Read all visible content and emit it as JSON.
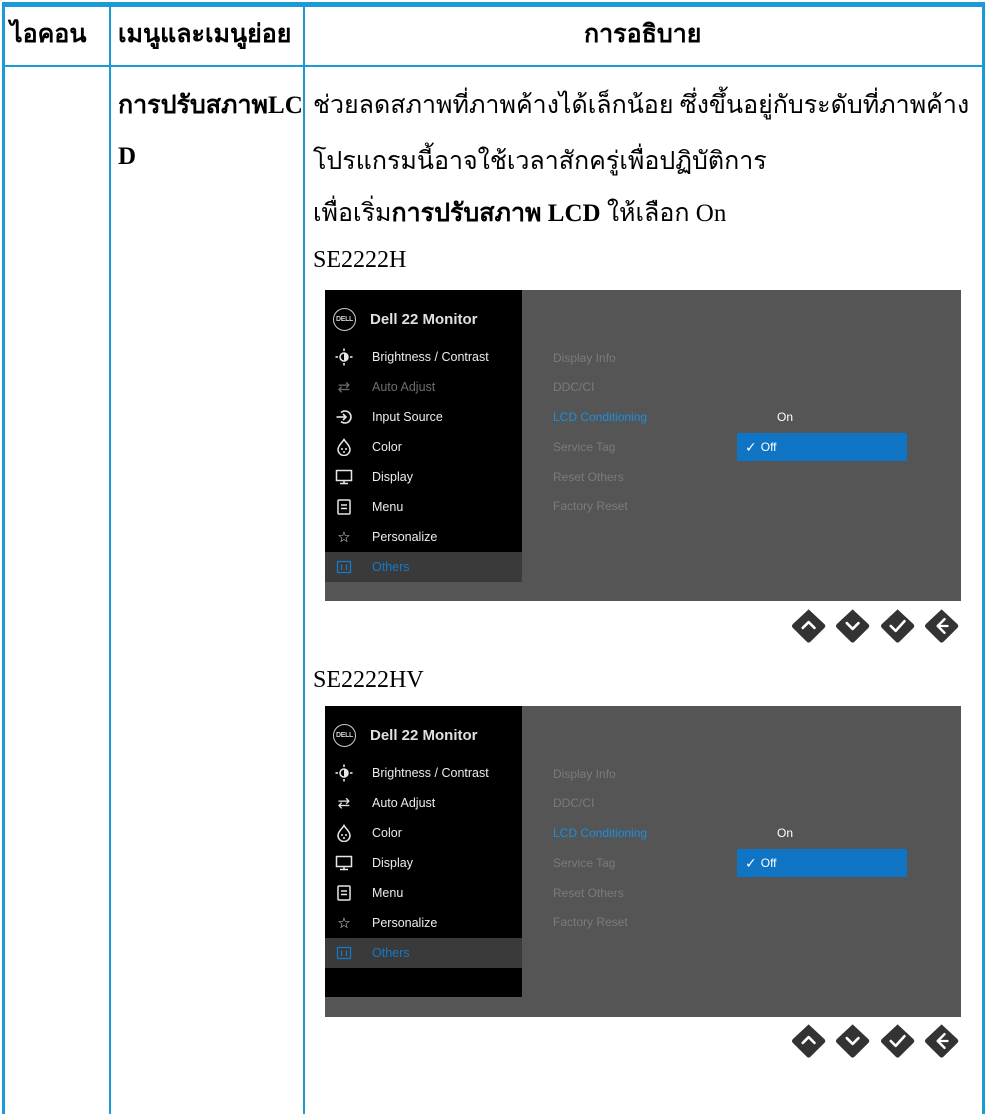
{
  "headers": {
    "icon": "ไอคอน",
    "menu": "เมนูและเมนูย่อย",
    "description": "การอธิบาย"
  },
  "submenu": {
    "name_line1": "การปรับสภาพLC",
    "name_line2": "D"
  },
  "description": {
    "line1": "ช่วยลดสภาพที่ภาพค้างได้เล็กน้อย ซึ่งขึ้นอยู่กับระดับที่ภาพค้าง",
    "line2": "โปรแกรมนี้อาจใช้เวลาสักครู่เพื่อปฏิบัติการ",
    "line3_prefix": "เพื่อเริ่ม",
    "line3_bold": "การปรับสภาพ LCD",
    "line3_suffix": " ให้เลือก On"
  },
  "screens": [
    {
      "model": "SE2222H",
      "brand_logo": "DELL",
      "title": "Dell 22 Monitor",
      "menu": [
        {
          "label": "Brightness / Contrast",
          "icon": "brightness-icon",
          "state": "normal"
        },
        {
          "label": "Auto Adjust",
          "icon": "auto-adjust-icon",
          "state": "dim"
        },
        {
          "label": "Input Source",
          "icon": "input-source-icon",
          "state": "normal"
        },
        {
          "label": "Color",
          "icon": "color-icon",
          "state": "normal"
        },
        {
          "label": "Display",
          "icon": "display-icon",
          "state": "normal"
        },
        {
          "label": "Menu",
          "icon": "menu-icon",
          "state": "normal"
        },
        {
          "label": "Personalize",
          "icon": "star-icon",
          "state": "normal"
        },
        {
          "label": "Others",
          "icon": "others-icon",
          "state": "selected"
        }
      ],
      "submenu": [
        "Display Info",
        "DDC/CI",
        "LCD Conditioning",
        "Service Tag",
        "Reset Others",
        "Factory Reset"
      ],
      "active_submenu": "LCD Conditioning",
      "option_on": "On",
      "option_off": "Off",
      "selected_option": "Off",
      "buttons": [
        "up-icon",
        "down-icon",
        "check-icon",
        "back-icon"
      ]
    },
    {
      "model": "SE2222HV",
      "brand_logo": "DELL",
      "title": "Dell 22 Monitor",
      "menu": [
        {
          "label": "Brightness / Contrast",
          "icon": "brightness-icon",
          "state": "normal"
        },
        {
          "label": "Auto Adjust",
          "icon": "auto-adjust-icon",
          "state": "normal"
        },
        {
          "label": "Color",
          "icon": "color-icon",
          "state": "normal"
        },
        {
          "label": "Display",
          "icon": "display-icon",
          "state": "normal"
        },
        {
          "label": "Menu",
          "icon": "menu-icon",
          "state": "normal"
        },
        {
          "label": "Personalize",
          "icon": "star-icon",
          "state": "normal"
        },
        {
          "label": "Others",
          "icon": "others-icon",
          "state": "selected"
        }
      ],
      "submenu": [
        "Display Info",
        "DDC/CI",
        "LCD Conditioning",
        "Service Tag",
        "Reset Others",
        "Factory Reset"
      ],
      "active_submenu": "LCD Conditioning",
      "option_on": "On",
      "option_off": "Off",
      "selected_option": "Off",
      "buttons": [
        "up-icon",
        "down-icon",
        "check-icon",
        "back-icon"
      ]
    }
  ],
  "colors": {
    "table_border": "#1a9ad6",
    "osd_bg": "#555555",
    "osd_menu_bg": "#000000",
    "highlight": "#0f74c4",
    "accent_text": "#1a8fe0"
  }
}
